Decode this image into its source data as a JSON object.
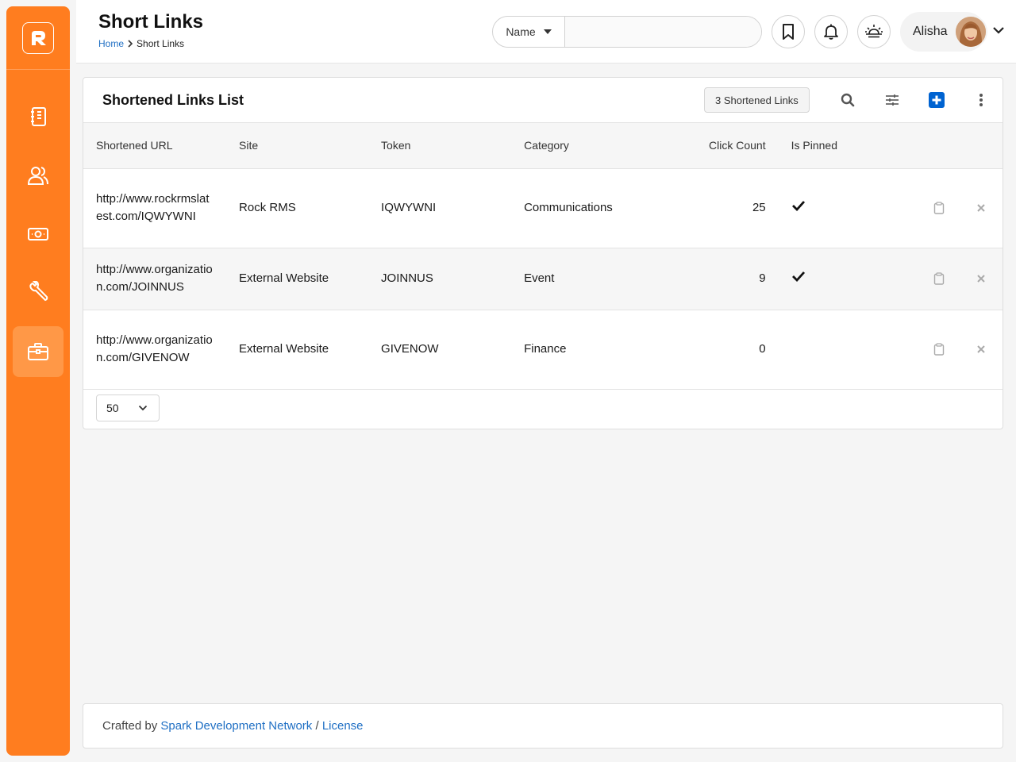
{
  "header": {
    "title": "Short Links",
    "breadcrumb": {
      "home": "Home",
      "current": "Short Links"
    },
    "search": {
      "select_value": "Name",
      "placeholder": ""
    },
    "user": {
      "name": "Alisha"
    }
  },
  "sidebar": {
    "items": [
      {
        "icon": "book-icon"
      },
      {
        "icon": "people-icon"
      },
      {
        "icon": "finance-icon"
      },
      {
        "icon": "tools-icon"
      },
      {
        "icon": "briefcase-icon",
        "active": true
      }
    ]
  },
  "card": {
    "title": "Shortened Links List",
    "count_badge": "3 Shortened Links"
  },
  "table": {
    "headers": [
      "Shortened URL",
      "Site",
      "Token",
      "Category",
      "Click Count",
      "Is Pinned"
    ],
    "rows": [
      {
        "url": "http://www.rockrmslatest.com/IQWYWNI",
        "site": "Rock RMS",
        "token": "IQWYWNI",
        "category": "Communications",
        "clicks": "25",
        "pinned": true
      },
      {
        "url": "http://www.organization.com/JOINNUS",
        "site": "External Website",
        "token": "JOINNUS",
        "category": "Event",
        "clicks": "9",
        "pinned": true
      },
      {
        "url": "http://www.organization.com/GIVENOW",
        "site": "External Website",
        "token": "GIVENOW",
        "category": "Finance",
        "clicks": "0",
        "pinned": false
      }
    ]
  },
  "pager": {
    "page_size": "50"
  },
  "footer": {
    "prefix": "Crafted by",
    "link1": "Spark Development Network",
    "separator": "/",
    "link2": "License"
  },
  "colors": {
    "brand": "#ff7d1f",
    "accent": "#1f6fc4",
    "add_button": "#0063d1"
  }
}
